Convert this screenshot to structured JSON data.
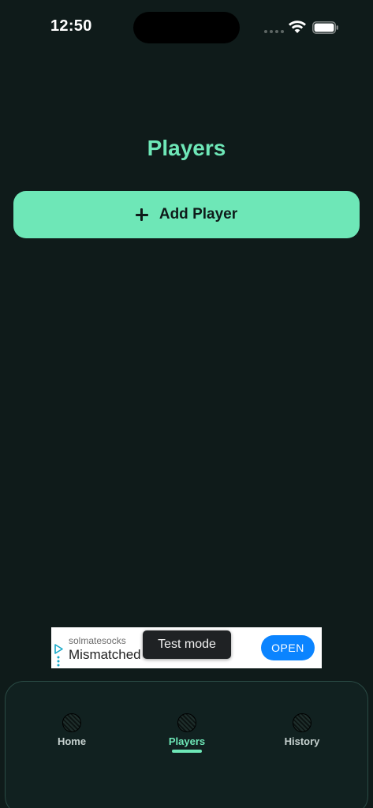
{
  "status_bar": {
    "time": "12:50"
  },
  "page": {
    "title": "Players"
  },
  "actions": {
    "add_player_label": "Add Player",
    "add_icon": "plus-icon"
  },
  "ad": {
    "advertiser": "solmatesocks",
    "headline": "Mismatched",
    "cta": "OPEN",
    "test_mode_label": "Test mode"
  },
  "tabs": [
    {
      "label": "Home",
      "icon": "ball-icon",
      "active": false
    },
    {
      "label": "Players",
      "icon": "ball-icon",
      "active": true
    },
    {
      "label": "History",
      "icon": "ball-icon",
      "active": false
    }
  ],
  "colors": {
    "background": "#0f1b1a",
    "accent": "#6ee7b7",
    "ad_button": "#0b84ff"
  }
}
